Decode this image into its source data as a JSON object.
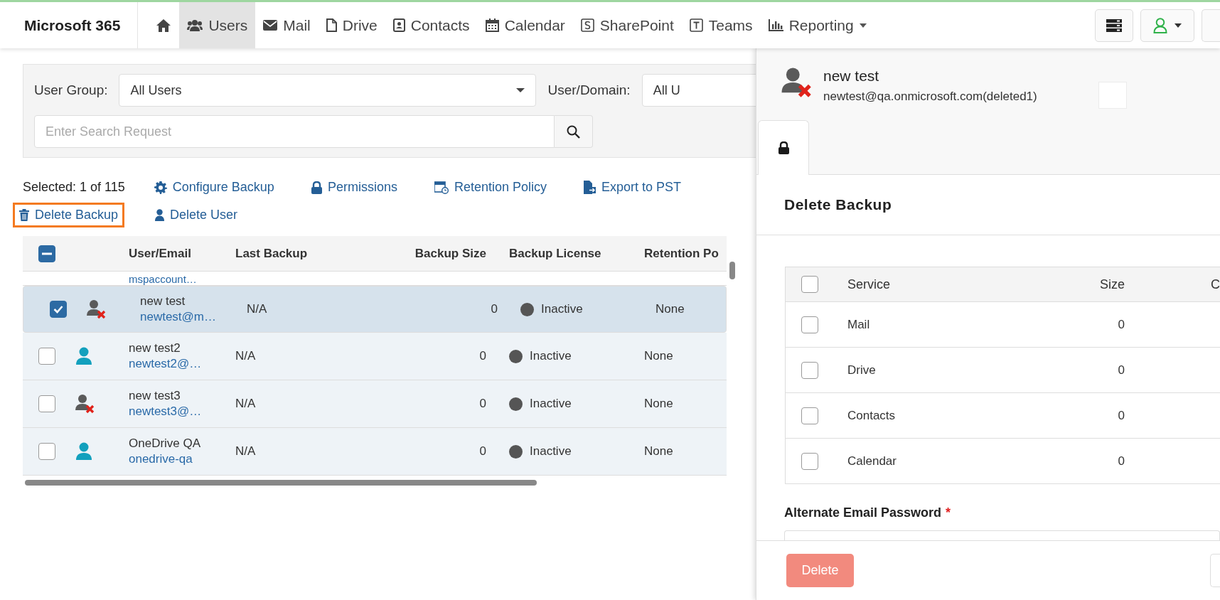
{
  "navbar": {
    "brand": "Microsoft 365",
    "items": [
      {
        "kind": "home",
        "selected": false
      },
      {
        "kind": "users",
        "label": "Users",
        "selected": true
      },
      {
        "kind": "mail",
        "label": "Mail",
        "selected": false
      },
      {
        "kind": "drive",
        "label": "Drive",
        "selected": false
      },
      {
        "kind": "contacts",
        "label": "Contacts",
        "selected": false
      },
      {
        "kind": "calendar",
        "label": "Calendar",
        "selected": false
      },
      {
        "kind": "sharepoint",
        "label": "SharePoint",
        "selected": false
      },
      {
        "kind": "teams",
        "label": "Teams",
        "selected": false
      },
      {
        "kind": "reporting",
        "label": "Reporting",
        "selected": false
      }
    ]
  },
  "filters": {
    "user_group_label": "User Group:",
    "user_group_value": "All Users",
    "user_domain_label": "User/Domain:",
    "user_domain_value": "All U",
    "search": {
      "placeholder": "Enter Search Request"
    }
  },
  "actions": {
    "selected_count": "Selected: 1 of 115",
    "links": [
      {
        "kind": "gear",
        "label": "Configure Backup",
        "highlighted": false
      },
      {
        "kind": "lock",
        "label": "Permissions",
        "highlighted": false
      },
      {
        "kind": "retention",
        "label": "Retention Policy",
        "highlighted": false
      },
      {
        "kind": "export",
        "label": "Export to PST",
        "highlighted": false
      },
      {
        "kind": "trash",
        "label": "Delete Backup",
        "highlighted": true
      },
      {
        "kind": "user",
        "label": "Delete User",
        "highlighted": false
      }
    ]
  },
  "table": {
    "header_checkbox": {
      "indeterminate": true
    },
    "columns": [
      "User/Email",
      "Last Backup",
      "Backup Size",
      "Backup License",
      "Retention Po"
    ],
    "partial_row": {
      "email": "mspaccount…"
    },
    "rows": [
      {
        "kind": "deleted",
        "selected": true,
        "name": "new test",
        "email": "newtest@m…",
        "last_backup": "N/A",
        "size": "0",
        "license": "Inactive",
        "retention": "None"
      },
      {
        "kind": "active",
        "selected": false,
        "name": "new test2",
        "email": "newtest2@…",
        "last_backup": "N/A",
        "size": "0",
        "license": "Inactive",
        "retention": "None"
      },
      {
        "kind": "deleted",
        "selected": false,
        "name": "new test3",
        "email": "newtest3@…",
        "last_backup": "N/A",
        "size": "0",
        "license": "Inactive",
        "retention": "None"
      },
      {
        "kind": "active",
        "selected": false,
        "name": "OneDrive QA",
        "email": "onedrive-qa",
        "last_backup": "N/A",
        "size": "0",
        "license": "Inactive",
        "retention": "None"
      }
    ]
  },
  "panel": {
    "user": {
      "kind": "deleted",
      "name": "new test",
      "email": "newtest@qa.onmicrosoft.com(deleted1)"
    },
    "tabs": [
      {
        "kind": "lock",
        "selected": true
      }
    ],
    "title": "Delete Backup",
    "services": {
      "header_checked": false,
      "columns": [
        "Service",
        "Size",
        "C"
      ],
      "rows": [
        {
          "service": "Mail",
          "size": "0",
          "checked": false
        },
        {
          "service": "Drive",
          "size": "0",
          "checked": false
        },
        {
          "service": "Contacts",
          "size": "0",
          "checked": false
        },
        {
          "service": "Calendar",
          "size": "0",
          "checked": false
        }
      ]
    },
    "password_label": "Alternate Email Password",
    "required_mark": "*",
    "delete_button": {
      "label": "Delete",
      "disabled": true
    }
  }
}
